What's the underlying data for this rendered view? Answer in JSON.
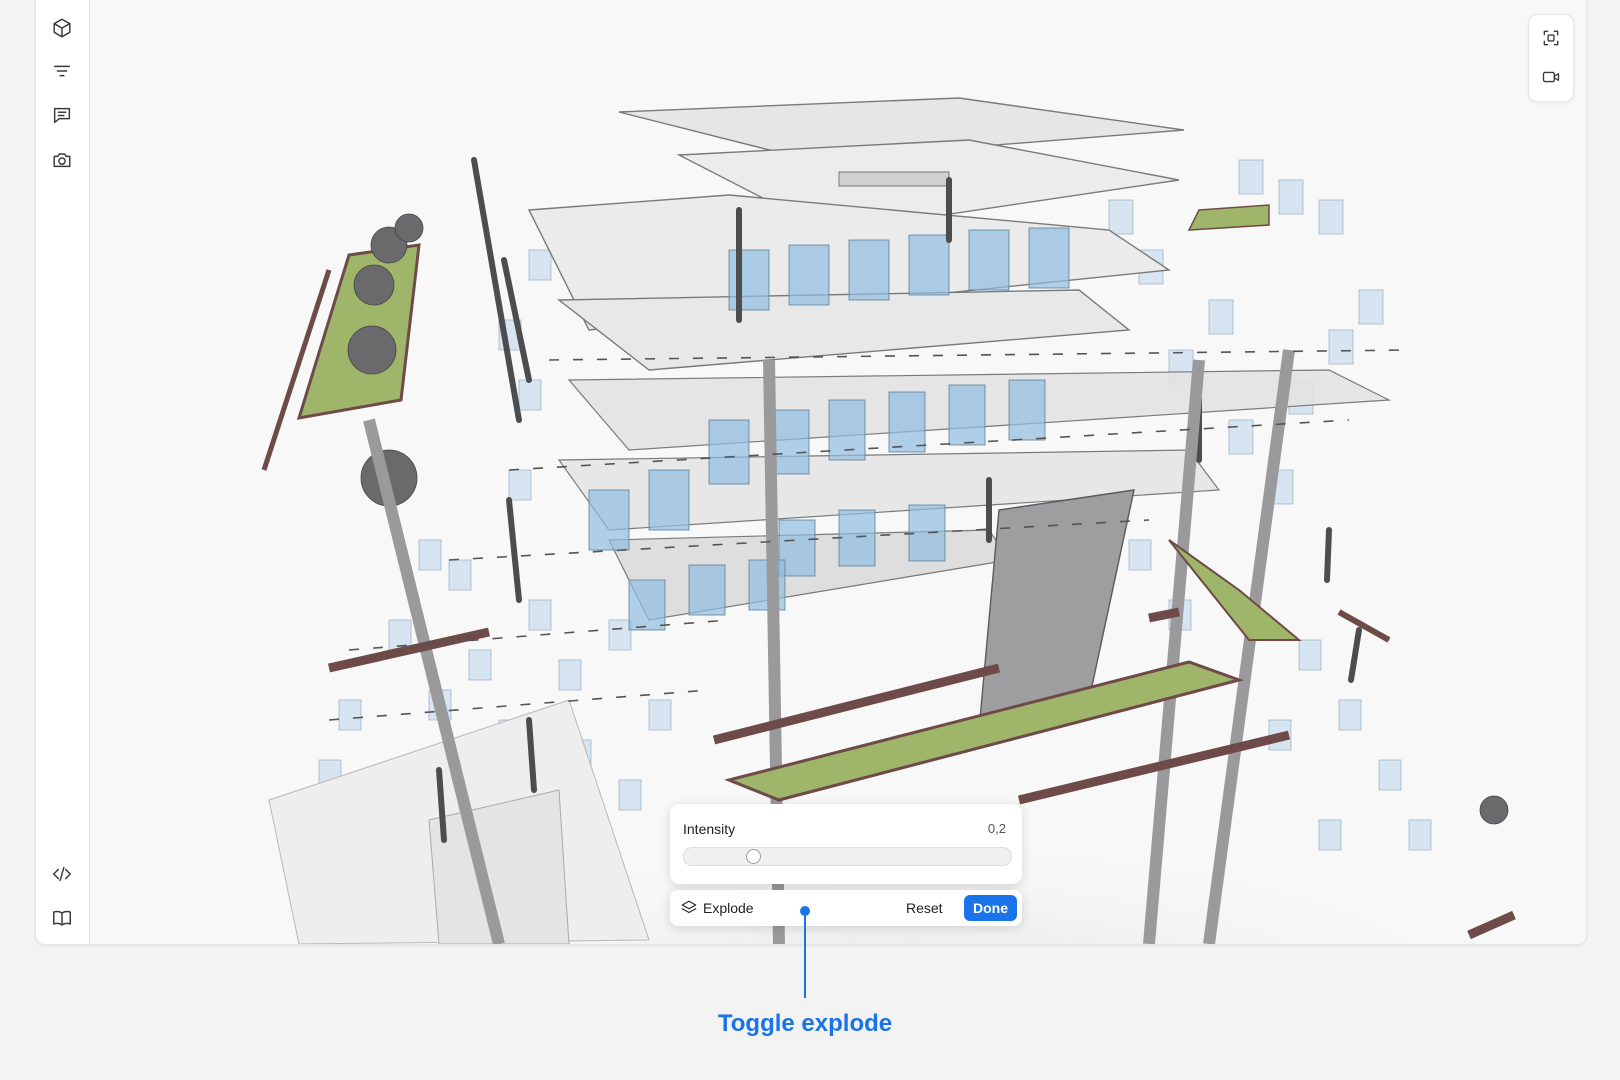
{
  "sidebar": {
    "top_icons": [
      "cube-icon",
      "filter-icon",
      "comment-icon",
      "camera-icon"
    ],
    "bottom_icons": [
      "code-icon",
      "book-icon"
    ]
  },
  "camera_panel": {
    "icons": [
      "focus-icon",
      "video-icon"
    ]
  },
  "intensity": {
    "label": "Intensity",
    "value": "0,2",
    "fraction": 0.2
  },
  "explode_bar": {
    "label": "Explode",
    "reset_label": "Reset",
    "done_label": "Done"
  },
  "callout": {
    "text": "Toggle explode"
  },
  "colors": {
    "accent": "#1a73e8",
    "grass": "#9fb56a",
    "beam": "#6e4a48",
    "glass": "#a9cce8"
  }
}
